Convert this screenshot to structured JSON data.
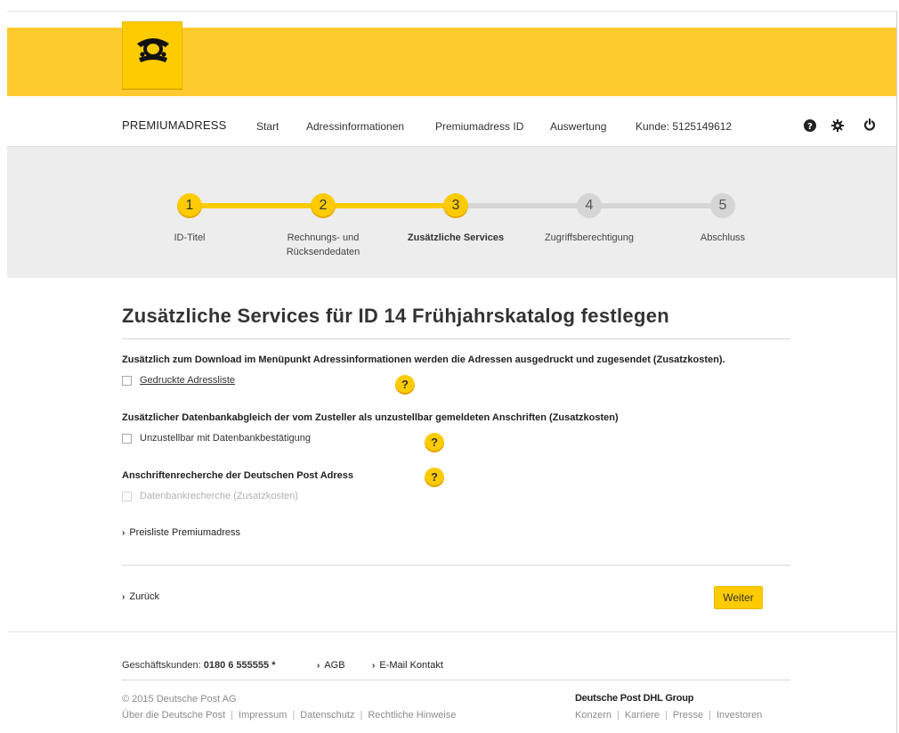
{
  "nav": {
    "brand": "PREMIUMADRESS",
    "items": [
      "Start",
      "Adressinformationen",
      "Premiumadress ID",
      "Auswertung"
    ],
    "customer": "Kunde: 5125149612"
  },
  "steps": [
    {
      "number": "1",
      "label": "ID-Titel",
      "state": "done"
    },
    {
      "number": "2",
      "label_line1": "Rechnungs- und",
      "label_line2": "Rücksendedaten",
      "state": "done"
    },
    {
      "number": "3",
      "label": "Zusätzliche Services",
      "state": "current"
    },
    {
      "number": "4",
      "label": "Zugriffsberechtigung",
      "state": "todo"
    },
    {
      "number": "5",
      "label": "Abschluss",
      "state": "todo"
    }
  ],
  "main": {
    "title": "Zusätzliche Services für ID 14 Frühjahrskatalog festlegen",
    "sections": [
      {
        "heading": "Zusätzlich zum Download im Menüpunkt Adressinformationen werden die Adressen ausgedruckt und zugesendet (Zusatzkosten).",
        "option": "Gedruckte Adressliste",
        "help": "?"
      },
      {
        "heading": "Zusätzlicher Datenbankabgleich der vom Zusteller als unzustellbar gemeldeten Anschriften (Zusatzkosten)",
        "option": "Unzustellbar mit Datenbankbestätigung",
        "help": "?"
      },
      {
        "heading": "Anschriftenrecherche der Deutschen Post Adress",
        "option": "Datenbankrecherche (Zusatzkosten)",
        "help": "?"
      }
    ],
    "pricelist_link": "Preisliste Premiumadress",
    "back_link": "Zurück",
    "next_button": "Weiter",
    "chevron": "›"
  },
  "footer": {
    "phone_label": "Geschäftskunden:",
    "phone_number": "0180 6 555555 *",
    "agb": "AGB",
    "email": "E-Mail Kontakt",
    "copyright": "© 2015 Deutsche Post AG",
    "links_left": [
      "Über die Deutsche Post",
      "Impressum",
      "Datenschutz",
      "Rechtliche Hinweise"
    ],
    "group": "Deutsche Post DHL Group",
    "links_right": [
      "Konzern",
      "Karriere",
      "Presse",
      "Investoren"
    ],
    "separator": "|"
  },
  "colors": {
    "brand_yellow": "#fecb00",
    "header_yellow": "#fecb2f",
    "step_inactive": "#d5d5d5",
    "steps_bg": "#ededed"
  },
  "icons": [
    "posthorn-logo-icon",
    "help-circle-icon",
    "gear-icon",
    "power-icon",
    "chevron-right-icon"
  ]
}
